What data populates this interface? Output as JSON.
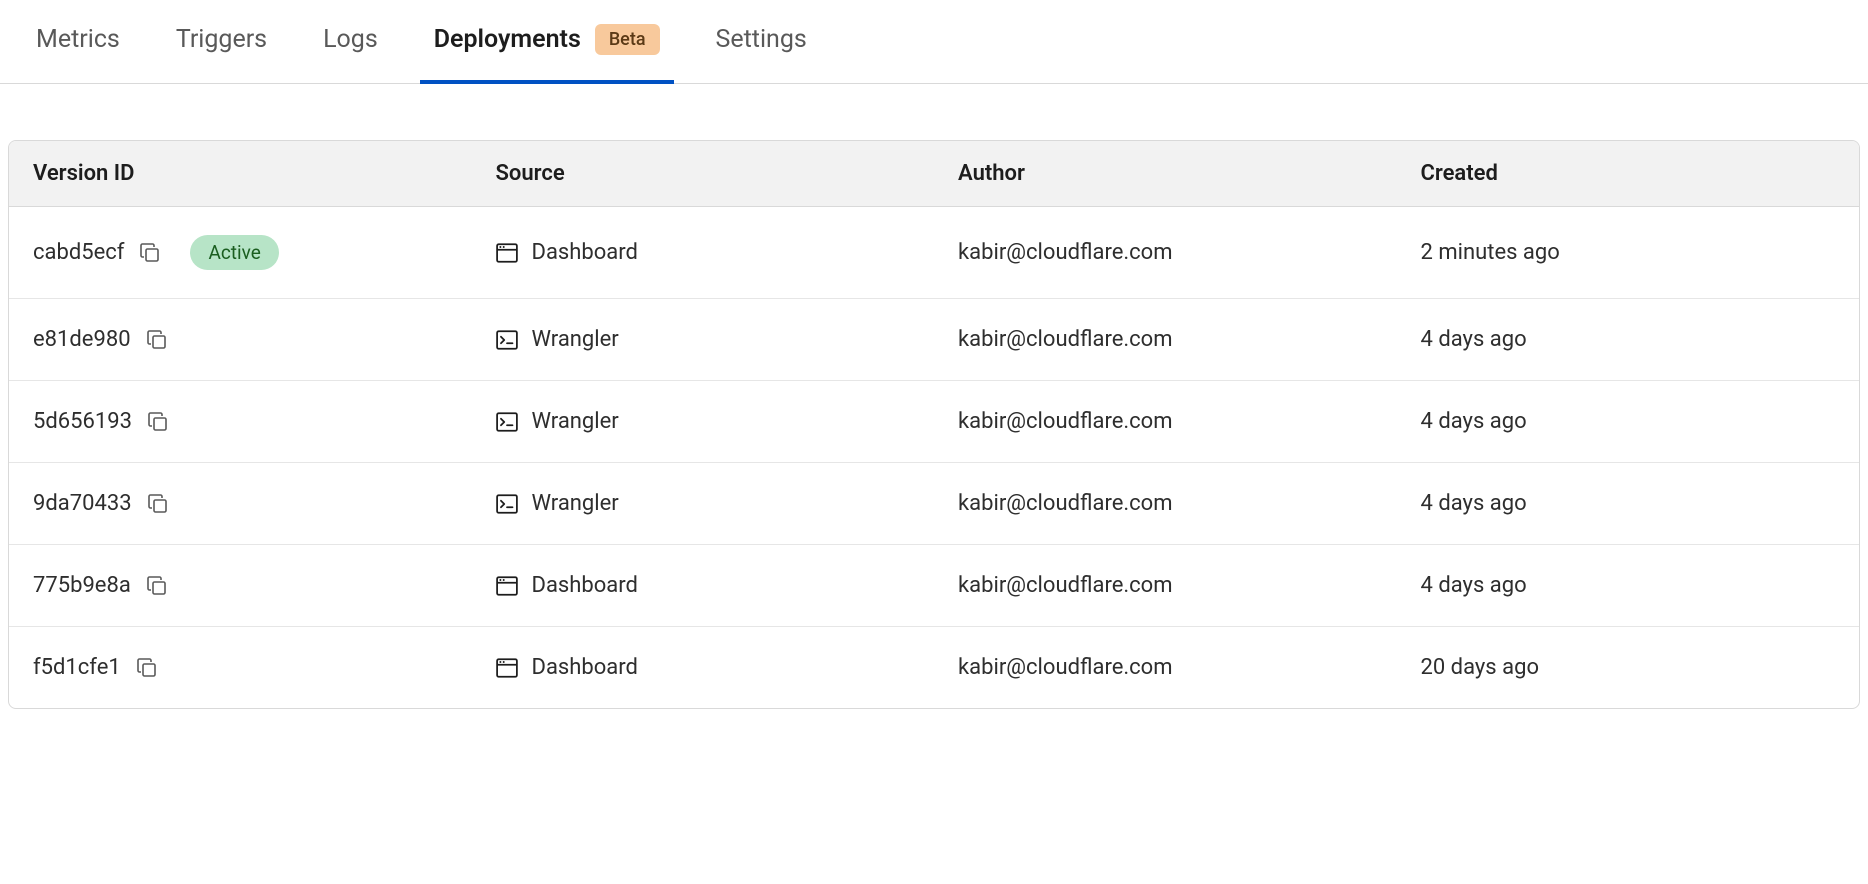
{
  "tabs": [
    {
      "label": "Metrics",
      "active": false,
      "badge": null
    },
    {
      "label": "Triggers",
      "active": false,
      "badge": null
    },
    {
      "label": "Logs",
      "active": false,
      "badge": null
    },
    {
      "label": "Deployments",
      "active": true,
      "badge": "Beta"
    },
    {
      "label": "Settings",
      "active": false,
      "badge": null
    }
  ],
  "table": {
    "headers": {
      "version": "Version ID",
      "source": "Source",
      "author": "Author",
      "created": "Created"
    },
    "rows": [
      {
        "version": "cabd5ecf",
        "active": true,
        "active_label": "Active",
        "source": "Dashboard",
        "source_icon": "dashboard",
        "author": "kabir@cloudflare.com",
        "created": "2 minutes ago"
      },
      {
        "version": "e81de980",
        "active": false,
        "active_label": "",
        "source": "Wrangler",
        "source_icon": "wrangler",
        "author": "kabir@cloudflare.com",
        "created": "4 days ago"
      },
      {
        "version": "5d656193",
        "active": false,
        "active_label": "",
        "source": "Wrangler",
        "source_icon": "wrangler",
        "author": "kabir@cloudflare.com",
        "created": "4 days ago"
      },
      {
        "version": "9da70433",
        "active": false,
        "active_label": "",
        "source": "Wrangler",
        "source_icon": "wrangler",
        "author": "kabir@cloudflare.com",
        "created": "4 days ago"
      },
      {
        "version": "775b9e8a",
        "active": false,
        "active_label": "",
        "source": "Dashboard",
        "source_icon": "dashboard",
        "author": "kabir@cloudflare.com",
        "created": "4 days ago"
      },
      {
        "version": "f5d1cfe1",
        "active": false,
        "active_label": "",
        "source": "Dashboard",
        "source_icon": "dashboard",
        "author": "kabir@cloudflare.com",
        "created": "20 days ago"
      }
    ]
  }
}
